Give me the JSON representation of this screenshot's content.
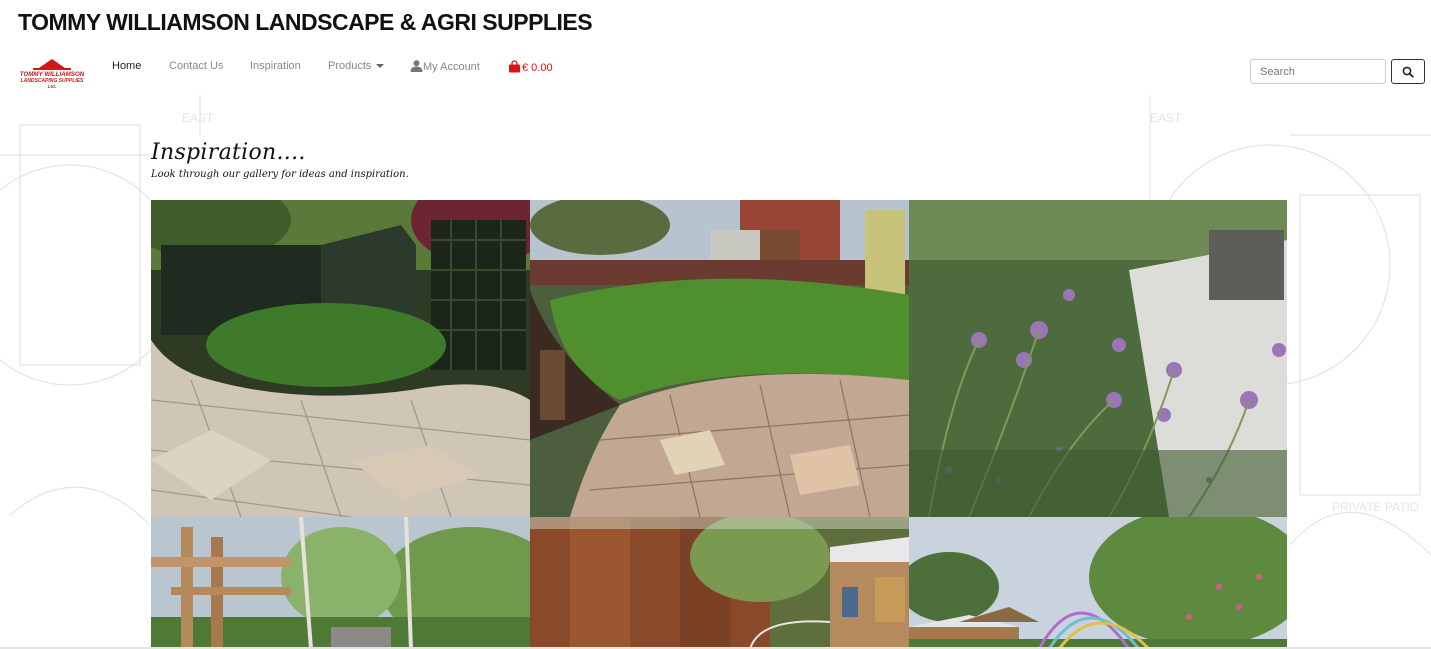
{
  "site": {
    "title": "TOMMY WILLIAMSON LANDSCAPE & AGRI SUPPLIES",
    "logo_text_line1": "TOMMY WILLIAMSON",
    "logo_text_line2": "LANDSCAPING SUPPLIES",
    "logo_text_line3": "Ltd."
  },
  "nav": {
    "items": [
      {
        "label": "Home",
        "active": true
      },
      {
        "label": "Contact Us"
      },
      {
        "label": "Inspiration"
      },
      {
        "label": "Products"
      },
      {
        "label": "My Account",
        "icon": "user-icon"
      },
      {
        "label": "€ 0.00",
        "icon": "shopping-bag-icon"
      }
    ]
  },
  "search": {
    "placeholder": "Search",
    "button_icon": "search-icon"
  },
  "page": {
    "heading": "Inspiration....",
    "subheading": "Look through our gallery for ideas and inspiration."
  },
  "colors": {
    "cart_red": "#dd1111",
    "logo_red": "#d01818",
    "nav_gray": "#888888"
  },
  "gallery": {
    "images": [
      {
        "name": "gallery-image-patio-lawn-shed"
      },
      {
        "name": "gallery-image-curved-lawn-pergola"
      },
      {
        "name": "gallery-image-allium-border"
      },
      {
        "name": "gallery-image-timber-pergola-birch"
      },
      {
        "name": "gallery-image-corten-wall-cabin"
      },
      {
        "name": "gallery-image-cabin-flower-arches"
      }
    ]
  }
}
